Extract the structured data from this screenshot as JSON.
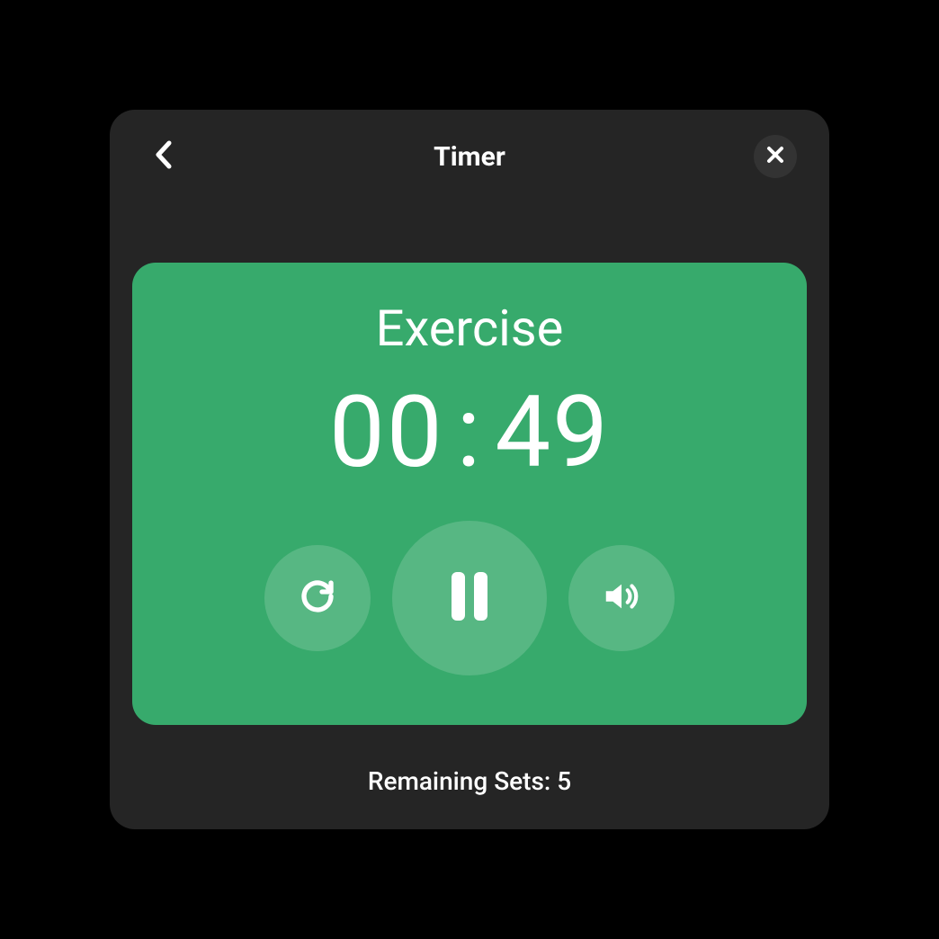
{
  "header": {
    "title": "Timer"
  },
  "timer": {
    "phase_label": "Exercise",
    "minutes": "00",
    "separator": ":",
    "seconds": "49"
  },
  "footer": {
    "remaining_label": "Remaining Sets: 5"
  },
  "icons": {
    "back": "chevron-left",
    "close": "x",
    "reset": "rotate-cw",
    "pause": "pause",
    "sound": "volume"
  },
  "colors": {
    "panel_bg": "#252525",
    "card_bg": "#37aa6c",
    "close_bg": "#333333"
  }
}
